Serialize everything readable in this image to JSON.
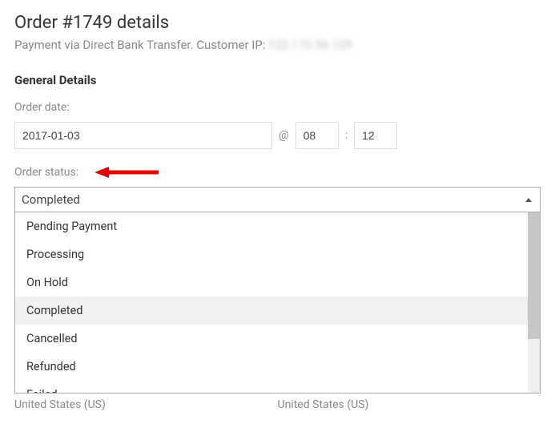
{
  "page_title": "Order #1749 details",
  "subtitle_prefix": "Payment via Direct Bank Transfer. Customer IP: ",
  "subtitle_ip_masked": "122.172.56.129",
  "section_title": "General Details",
  "order_date_label": "Order date:",
  "order_date_value": "2017-01-03",
  "at_separator": "@",
  "hour_value": "08",
  "colon": ":",
  "minute_value": "12",
  "order_status_label": "Order status:",
  "selected_status": "Completed",
  "status_options": {
    "o0": "Pending Payment",
    "o1": "Processing",
    "o2": "On Hold",
    "o3": "Completed",
    "o4": "Cancelled",
    "o5": "Refunded",
    "o6": "Failed"
  },
  "footer_left": "United States (US)",
  "footer_right": "United States (US)"
}
